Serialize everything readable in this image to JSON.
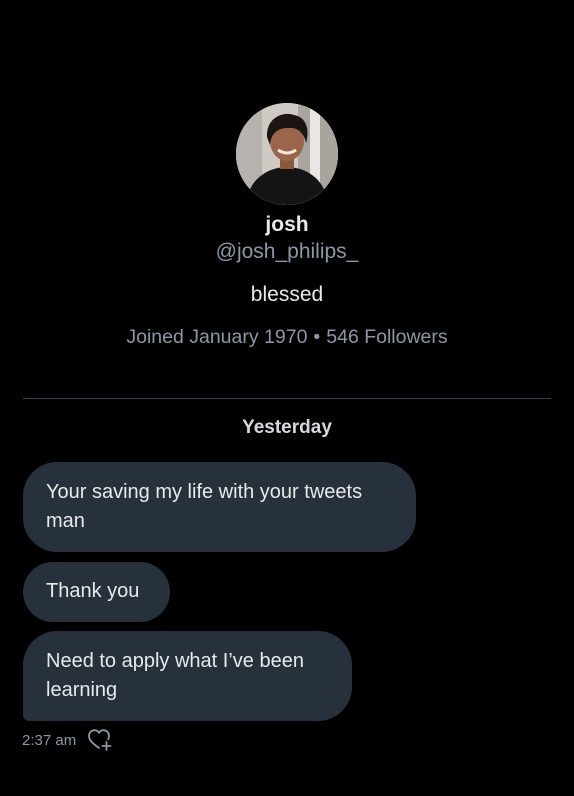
{
  "profile": {
    "display_name": "josh",
    "handle": "@josh_philips_",
    "bio": "blessed",
    "joined": "Joined January 1970",
    "separator": "•",
    "followers": "546 Followers"
  },
  "conversation": {
    "day_label": "Yesterday",
    "messages": [
      {
        "text": "Your saving my life with your tweets man"
      },
      {
        "text": "Thank you"
      },
      {
        "text": "Need to apply what I’ve been learning"
      }
    ],
    "timestamp": "2:37 am",
    "reaction_icon": "heart-plus-icon"
  },
  "colors": {
    "background": "#000000",
    "bubble": "#26313b",
    "primary_text": "#e7e9ea",
    "secondary_text": "#8b98a5",
    "divider": "#38444d"
  }
}
